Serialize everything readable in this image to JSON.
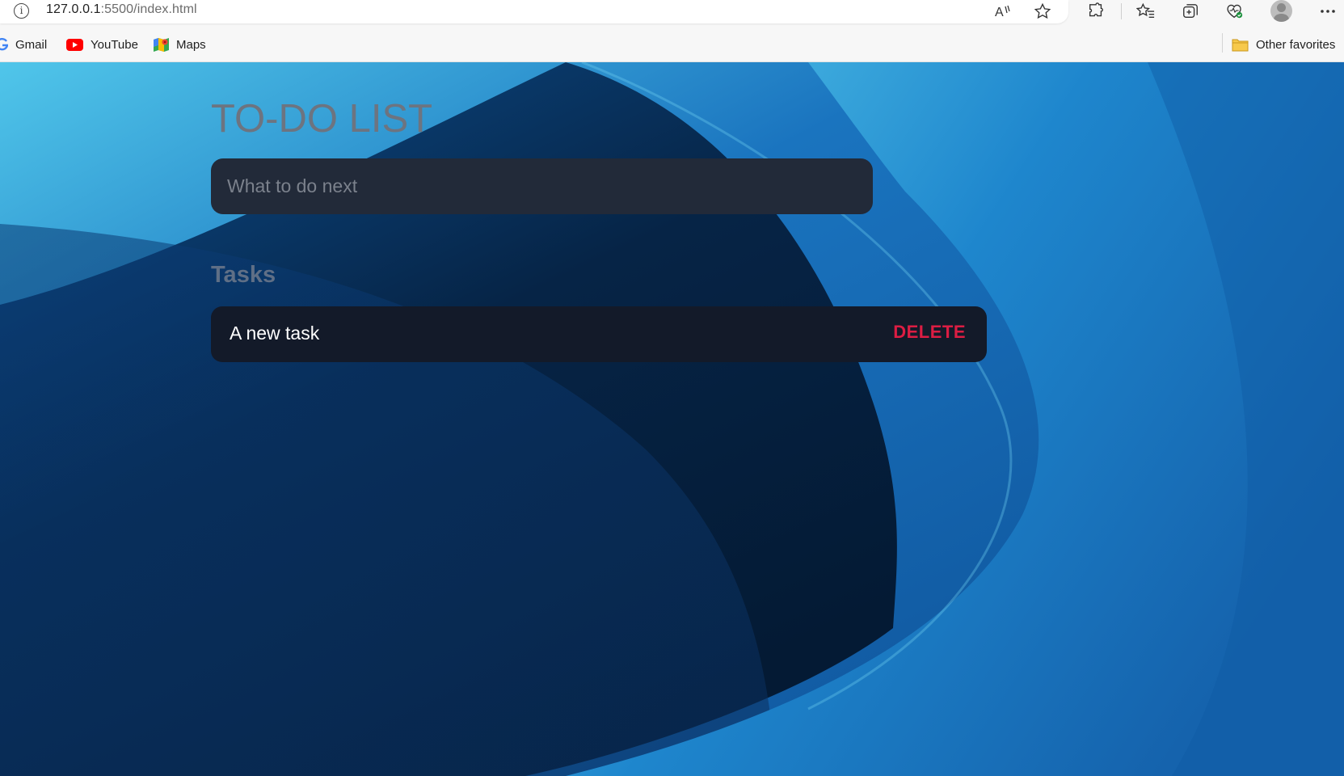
{
  "browser": {
    "url_host": "127.0.0.1",
    "url_path": ":5500/index.html",
    "icons": [
      "info-icon",
      "read-aloud-icon",
      "favorite-star-icon",
      "extensions-icon",
      "favorites-icon",
      "collections-icon",
      "browser-essentials-icon",
      "profile-avatar-icon",
      "more-menu-icon"
    ]
  },
  "bookmarks": {
    "items": [
      {
        "label": "Gmail",
        "icon": "google-icon"
      },
      {
        "label": "YouTube",
        "icon": "youtube-icon"
      },
      {
        "label": "Maps",
        "icon": "maps-icon"
      }
    ],
    "other_favorites": "Other favorites"
  },
  "app": {
    "title": "TO-DO LIST",
    "input_placeholder": "What to do next",
    "input_value": "",
    "tasks_heading": "Tasks",
    "tasks": [
      {
        "text": "A new task",
        "delete_label": "DELETE"
      }
    ]
  },
  "colors": {
    "delete": "#dc1d43",
    "input_bg": "#222a39",
    "task_bg": "#131a29",
    "title": "#6d7480"
  }
}
